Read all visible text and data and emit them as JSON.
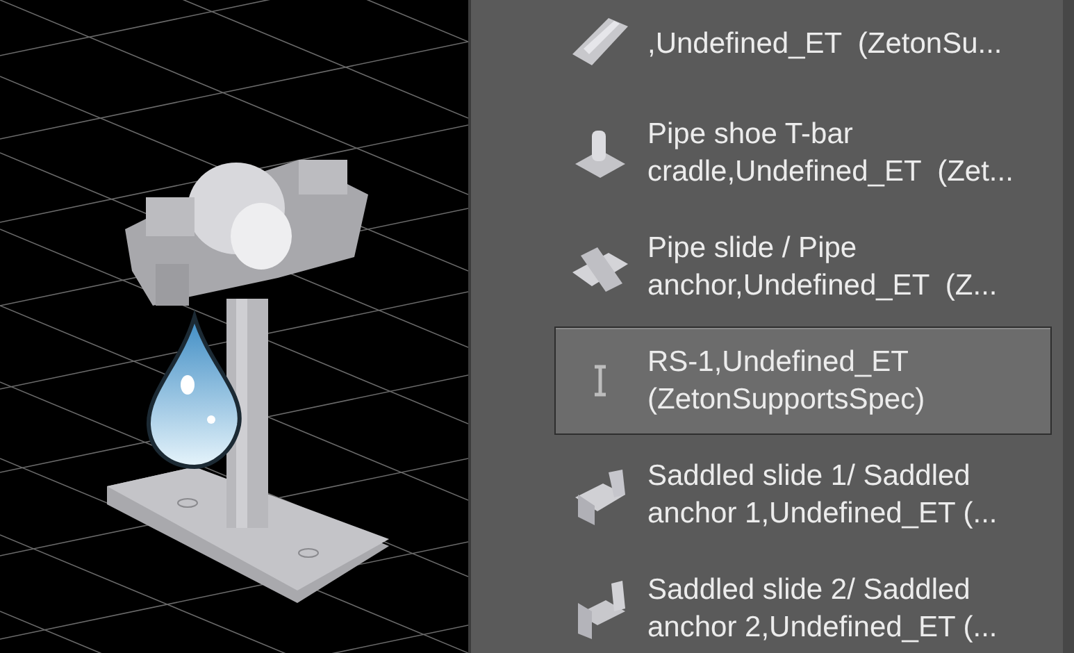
{
  "palette": {
    "items": [
      {
        "label": ",Undefined_ET  (ZetonSu...",
        "selected": false
      },
      {
        "label": "Pipe shoe T-bar\ncradle,Undefined_ET  (Zet...",
        "selected": false
      },
      {
        "label": "Pipe slide / Pipe\nanchor,Undefined_ET  (Z...",
        "selected": false
      },
      {
        "label": "RS-1,Undefined_ET\n(ZetonSupportsSpec)",
        "selected": true
      },
      {
        "label": "Saddled slide 1/ Saddled\nanchor 1,Undefined_ET (...",
        "selected": false
      },
      {
        "label": "Saddled slide 2/ Saddled\nanchor 2,Undefined_ET (...",
        "selected": false
      }
    ]
  }
}
